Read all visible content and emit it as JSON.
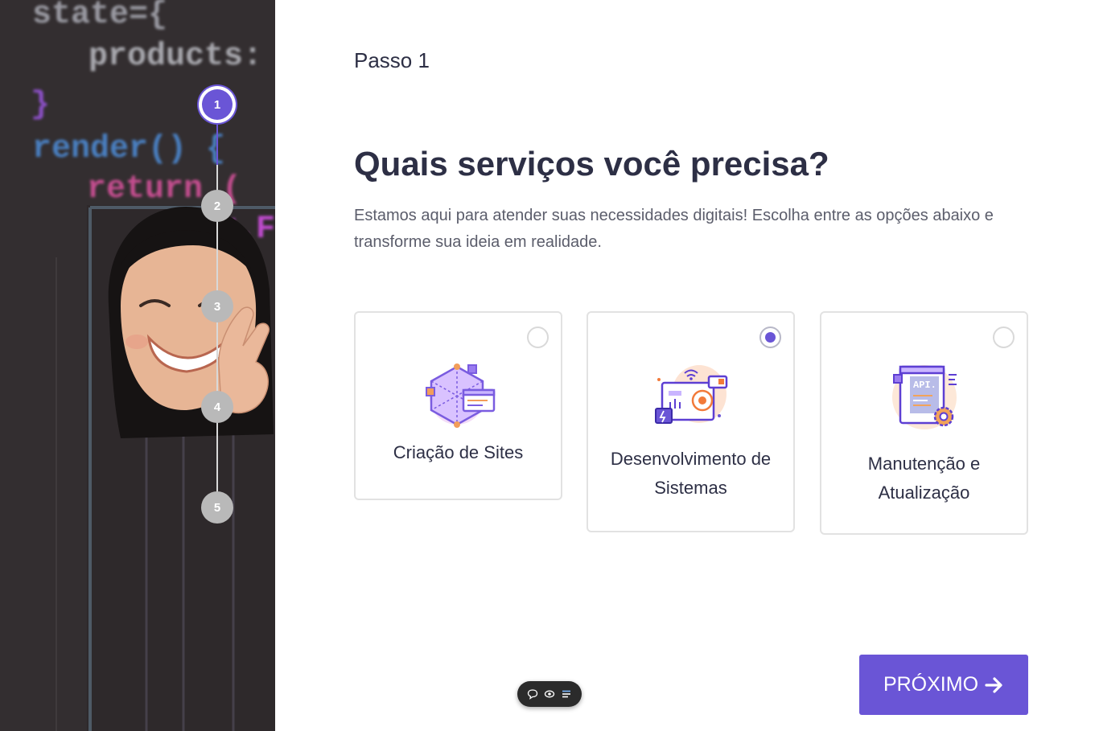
{
  "sidebar": {
    "steps": [
      {
        "number": "1",
        "state": "active"
      },
      {
        "number": "2",
        "state": "pending"
      },
      {
        "number": "3",
        "state": "pending"
      },
      {
        "number": "4",
        "state": "pending"
      },
      {
        "number": "5",
        "state": "pending"
      }
    ],
    "backdrop_code_lines": [
      "state={",
      "products: sto",
      "}",
      "render() {",
      "return (",
      "<.Fr"
    ]
  },
  "main": {
    "step_label": "Passo 1",
    "title": "Quais serviços você precisa?",
    "subtitle": "Estamos aqui para atender suas necessidades digitais! Escolha entre as opções abaixo e transforme sua ideia em realidade.",
    "options": [
      {
        "label": "Criação de Sites",
        "icon": "website-creation-icon",
        "selected": false
      },
      {
        "label": "Desenvolvimento de Sistemas",
        "icon": "systems-development-icon",
        "selected": true
      },
      {
        "label": "Manutenção e Atualização",
        "icon": "api-maintenance-icon",
        "selected": false
      }
    ],
    "next_label": "PRÓXIMO"
  },
  "toolbar": {
    "icons": [
      "comment-icon",
      "eye-icon",
      "menu-icon"
    ]
  },
  "colors": {
    "accent": "#6a55d6",
    "title": "#2d2f45",
    "text_muted": "#5b5d6b",
    "step_inactive": "#b9b9b9",
    "card_border": "#e2e2e2"
  }
}
